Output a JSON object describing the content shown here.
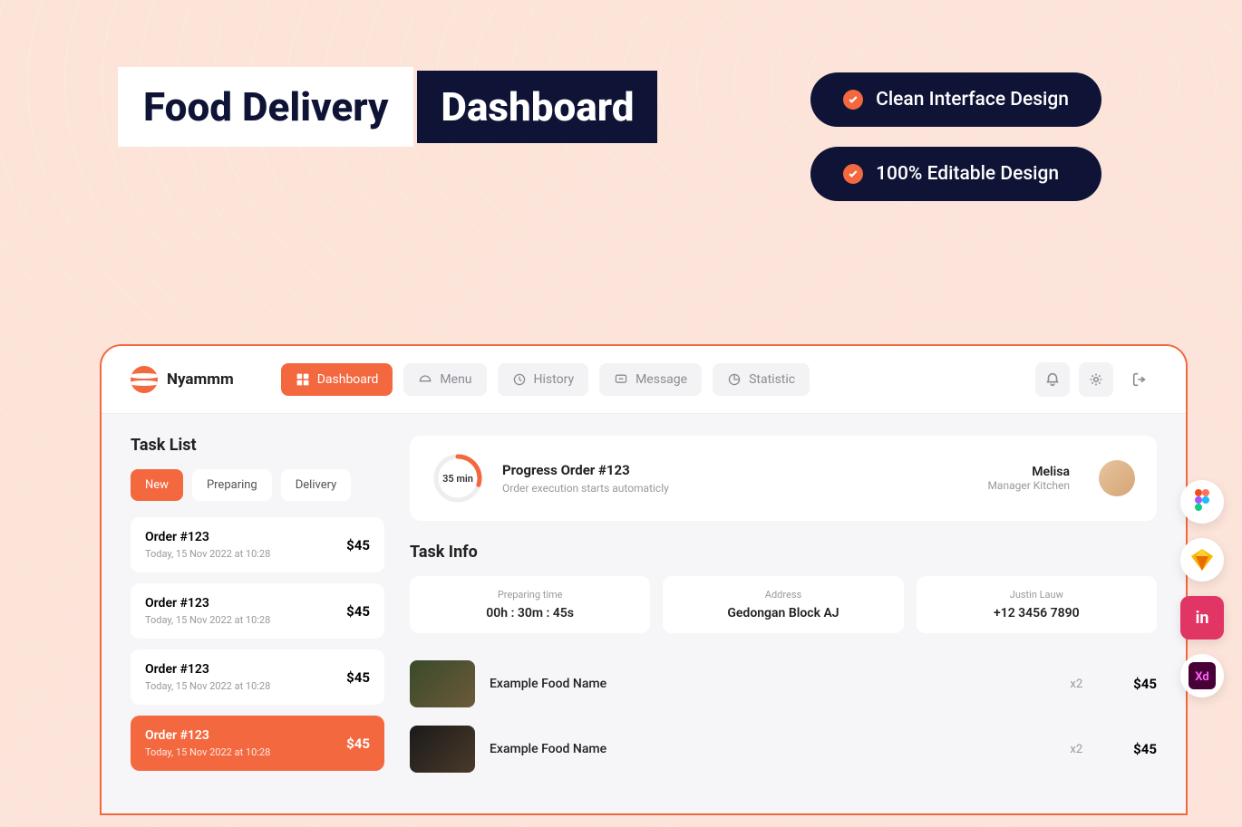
{
  "hero": {
    "line1": "Food Delivery",
    "line2": "Dashboard"
  },
  "pills": [
    {
      "text": "Clean Interface Design"
    },
    {
      "text": "100% Editable Design"
    }
  ],
  "brand": "Nyammm",
  "nav": [
    {
      "label": "Dashboard",
      "active": true
    },
    {
      "label": "Menu"
    },
    {
      "label": "History"
    },
    {
      "label": "Message"
    },
    {
      "label": "Statistic"
    }
  ],
  "taskList": {
    "title": "Task List",
    "tabs": [
      {
        "label": "New",
        "active": true
      },
      {
        "label": "Preparing"
      },
      {
        "label": "Delivery"
      }
    ],
    "orders": [
      {
        "title": "Order #123",
        "meta": "Today, 15 Nov 2022 at 10:28",
        "price": "$45"
      },
      {
        "title": "Order #123",
        "meta": "Today, 15 Nov 2022 at 10:28",
        "price": "$45"
      },
      {
        "title": "Order #123",
        "meta": "Today, 15 Nov 2022 at 10:28",
        "price": "$45"
      },
      {
        "title": "Order #123",
        "meta": "Today, 15 Nov 2022 at 10:28",
        "price": "$45",
        "active": true
      }
    ]
  },
  "progress": {
    "time": "35 min",
    "title": "Progress Order #123",
    "sub": "Order execution starts automaticly",
    "manager": {
      "name": "Melisa",
      "role": "Manager Kitchen"
    }
  },
  "taskInfo": {
    "title": "Task Info",
    "cards": [
      {
        "label": "Preparing time",
        "value": "00h : 30m : 45s"
      },
      {
        "label": "Address",
        "value": "Gedongan Block AJ"
      },
      {
        "label": "Justin Lauw",
        "value": "+12 3456 7890"
      }
    ],
    "items": [
      {
        "name": "Example Food Name",
        "qty": "x2",
        "price": "$45"
      },
      {
        "name": "Example Food Name",
        "qty": "x2",
        "price": "$45"
      }
    ]
  },
  "tools": [
    "figma",
    "sketch",
    "invision",
    "xd"
  ]
}
